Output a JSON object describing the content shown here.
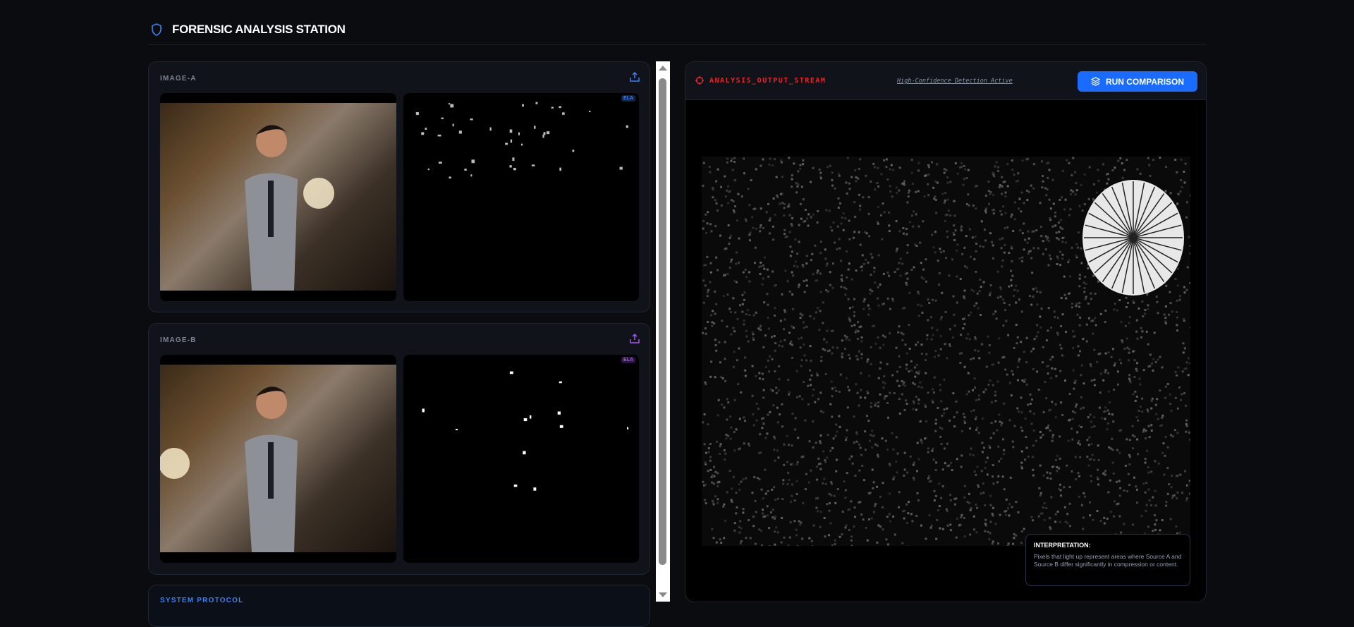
{
  "header": {
    "title": "FORENSIC ANALYSIS STATION",
    "icon": "shield-icon"
  },
  "panels": [
    {
      "label": "IMAGE-A",
      "tag": "ELA",
      "accent": "#3b82f6"
    },
    {
      "label": "IMAGE-B",
      "tag": "ELA",
      "accent": "#a855f7"
    }
  ],
  "protocol": {
    "label": "SYSTEM PROTOCOL"
  },
  "output": {
    "title": "ANALYSIS_OUTPUT_STREAM",
    "status": "High-Confidence Detection Active",
    "run_label": "RUN COMPARISON",
    "interpretation_title": "INTERPRETATION:",
    "interpretation_text": "Pixels that light up represent areas where Source A and Source B differ significantly in compression or content."
  }
}
